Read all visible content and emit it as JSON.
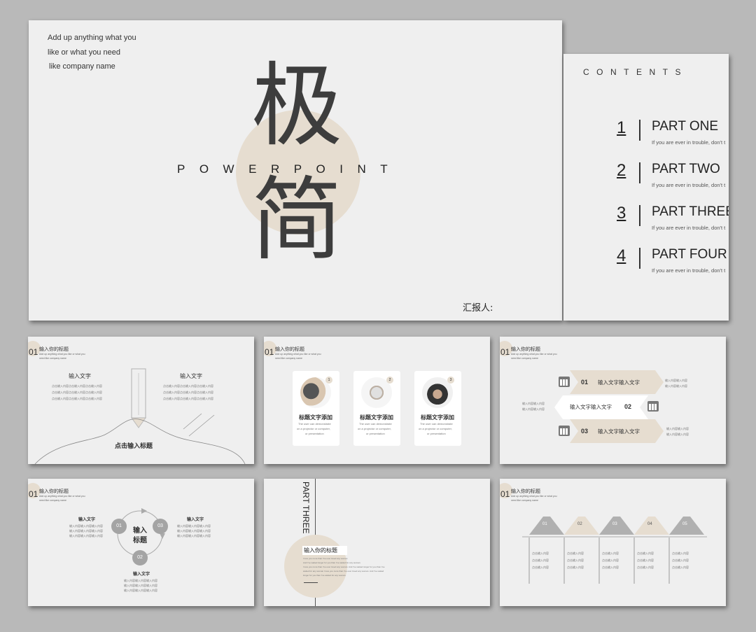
{
  "cover": {
    "tagline": [
      "Add up anything what you",
      "like or what you need",
      "like company name"
    ],
    "char1": "极",
    "char2": "简",
    "powerpoint": "POWERPOINT",
    "reporter": "汇报人:"
  },
  "contents": {
    "title": "CONTENTS",
    "items": [
      {
        "num": "1",
        "label": "PART ONE",
        "desc": "If you are ever in trouble, don't t"
      },
      {
        "num": "2",
        "label": "PART TWO",
        "desc": "If you are ever in trouble, don't t"
      },
      {
        "num": "3",
        "label": "PART THREE",
        "desc": "If you are ever in trouble, don't t"
      },
      {
        "num": "4",
        "label": "PART FOUR",
        "desc": "If you are ever in trouble, don't t"
      }
    ]
  },
  "header": {
    "num": "01",
    "title": "输入你的标题",
    "sub1": "Add up anything what you like or what you",
    "sub2": "need like company name"
  },
  "s1": {
    "left_title": "输入文字",
    "right_title": "输入文字",
    "lines": [
      "点击输入内容点击输入内容点击输入内容",
      "点击输入内容点击输入内容点击输入内容",
      "点击输入内容点击输入内容点击输入内容"
    ],
    "bottom": "点击输入标题"
  },
  "s2": {
    "cards": [
      {
        "badge": "1",
        "title": "标题文字添加",
        "desc": [
          "The user can demonstrate",
          "on a projector or computer,",
          "or presentation"
        ]
      },
      {
        "badge": "2",
        "title": "标题文字添加",
        "desc": [
          "The user can demonstrate",
          "on a projector or computer,",
          "or presentation"
        ]
      },
      {
        "badge": "3",
        "title": "标题文字添加",
        "desc": [
          "The user can demonstrate",
          "on a projector or computer,",
          "or presentation"
        ]
      }
    ]
  },
  "s3": {
    "rows": [
      {
        "num": "01",
        "text": "输入文字输入文字"
      },
      {
        "num": "02",
        "text": "输入文字输入文字"
      },
      {
        "num": "03",
        "text": "输入文字输入文字"
      }
    ],
    "side": [
      "输入内容输入内容",
      "输入内容输入内容"
    ]
  },
  "s4": {
    "center": [
      "输入",
      "标题"
    ],
    "nums": [
      "01",
      "02",
      "03"
    ],
    "label": "输入文字",
    "lines": [
      "输入内容输入内容输入内容",
      "输入内容输入内容输入内容",
      "输入内容输入内容输入内容"
    ]
  },
  "s5": {
    "vertical": "PART THREE",
    "title": "输入你的标题",
    "lines": [
      "I love you more than I've ever loved any woman",
      "And I've waited longer for you than I've waited for any woman.",
      "I love you more than I've ever loved any woman. And I've waited longer for you than I've",
      "waited for any woman I love you more than I've ever loved any woman. And I've waited",
      "longer for you than I've waited for any woman."
    ]
  },
  "s6": {
    "tabs": [
      "01",
      "02",
      "03",
      "04",
      "05"
    ],
    "cell": [
      "点击输入内容",
      "点击输入内容",
      "点击输入内容"
    ]
  },
  "colors": {
    "beige": "#e6ddd0",
    "dark": "#3d3d3d",
    "gray": "#a4a4a4"
  }
}
